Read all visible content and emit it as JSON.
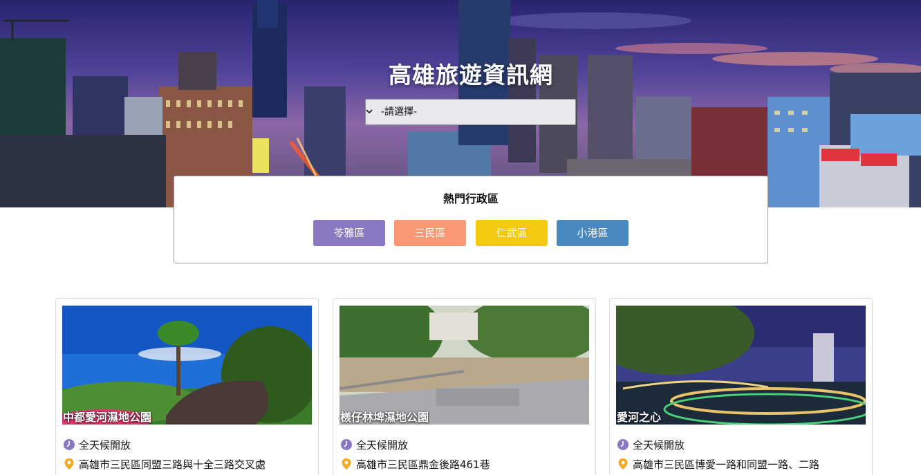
{
  "site": {
    "title": "高雄旅遊資訊網"
  },
  "district_select": {
    "selected": "-請選擇-"
  },
  "popular": {
    "title": "熱門行政區",
    "districts": [
      {
        "label": "苓雅區",
        "color": "#8a79c2"
      },
      {
        "label": "三民區",
        "color": "#fa9874"
      },
      {
        "label": "仁武區",
        "color": "#f4c90f"
      },
      {
        "label": "小港區",
        "color": "#4a88c0"
      }
    ]
  },
  "attractions": [
    {
      "name": "中都愛河濕地公園",
      "hours": "全天候開放",
      "address": "高雄市三民區同盟三路與十全三路交叉處"
    },
    {
      "name": "檨仔林埤濕地公園",
      "hours": "全天候開放",
      "address": "高雄市三民區鼎金後路461巷"
    },
    {
      "name": "愛河之心",
      "hours": "全天候開放",
      "address": "高雄市三民區博愛一路和同盟一路、二路"
    }
  ],
  "icons": {
    "hours": "clock-icon",
    "address": "map-pin-icon"
  },
  "colors": {
    "clock_icon": "#8a79c2",
    "pin_icon": "#f5a623"
  }
}
